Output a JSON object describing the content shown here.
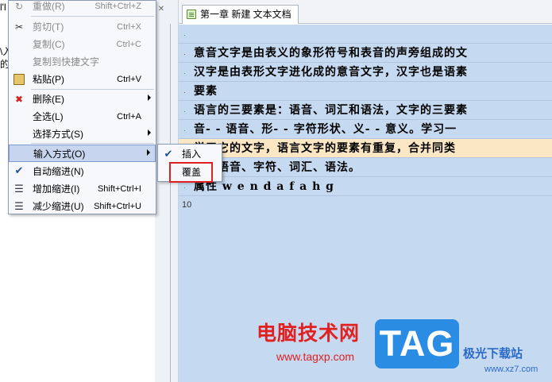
{
  "tab": {
    "title": "第一章 新建 文本文档"
  },
  "left_fragments": [
    "l'l",
    "\\入",
    "的"
  ],
  "editor": {
    "lines": [
      {
        "marker": "·",
        "text": ""
      },
      {
        "marker": "·",
        "text": "意音文字是由表义的象形符号和表音的声旁组成的文"
      },
      {
        "marker": "·",
        "text": "汉字是由表形文字进化成的意音文字，汉字也是语素"
      },
      {
        "marker": "·",
        "text": "要素"
      },
      {
        "marker": "·",
        "text": "语言的三要素是：语音、词汇和语法，文字的三要素"
      },
      {
        "marker": "·",
        "text": "音- - 语音、形- - 字符形状、义- - 意义。学习一"
      },
      {
        "marker": "·",
        "text": "学习它的文字，语言文字的要素有重复，合并同类"
      },
      {
        "marker": "·",
        "text": "素：语音、字符、词汇、语法。"
      },
      {
        "marker": "·",
        "text": "属性  w e n d a f a h g"
      },
      {
        "marker": "10",
        "text": ""
      }
    ]
  },
  "menu": {
    "items": [
      {
        "label": "重做(R)",
        "shortcut": "Shift+Ctrl+Z",
        "icon": "redo-icon",
        "disabled": true
      },
      {
        "label": "剪切(T)",
        "shortcut": "Ctrl+X",
        "icon": "scissors-icon",
        "disabled": true
      },
      {
        "label": "复制(C)",
        "shortcut": "Ctrl+C",
        "icon": "",
        "disabled": true
      },
      {
        "label": "复制到快捷文字",
        "shortcut": "",
        "icon": "",
        "disabled": true
      },
      {
        "label": "粘贴(P)",
        "shortcut": "Ctrl+V",
        "icon": "paste-icon",
        "disabled": false
      },
      {
        "label": "删除(E)",
        "shortcut": "",
        "icon": "delete-icon",
        "disabled": false
      },
      {
        "label": "全选(L)",
        "shortcut": "Ctrl+A",
        "icon": "",
        "disabled": false
      },
      {
        "label": "选择方式(S)",
        "shortcut": "",
        "icon": "",
        "disabled": false
      },
      {
        "label": "输入方式(O)",
        "shortcut": "",
        "icon": "",
        "disabled": false
      },
      {
        "label": "自动缩进(N)",
        "shortcut": "",
        "icon": "check-icon",
        "disabled": false
      },
      {
        "label": "增加缩进(I)",
        "shortcut": "Shift+Ctrl+I",
        "icon": "indent-icon",
        "disabled": false
      },
      {
        "label": "减少缩进(U)",
        "shortcut": "Shift+Ctrl+U",
        "icon": "outdent-icon",
        "disabled": false
      }
    ]
  },
  "submenu": {
    "items": [
      {
        "label": "插入",
        "checked": true
      },
      {
        "label": "覆盖",
        "checked": false
      }
    ]
  },
  "watermark": {
    "cn": "电脑技术网",
    "url": "www.tagxp.com",
    "tag": "TAG",
    "right_cn": "极光下载站",
    "right_url": "www.xz7.com"
  }
}
